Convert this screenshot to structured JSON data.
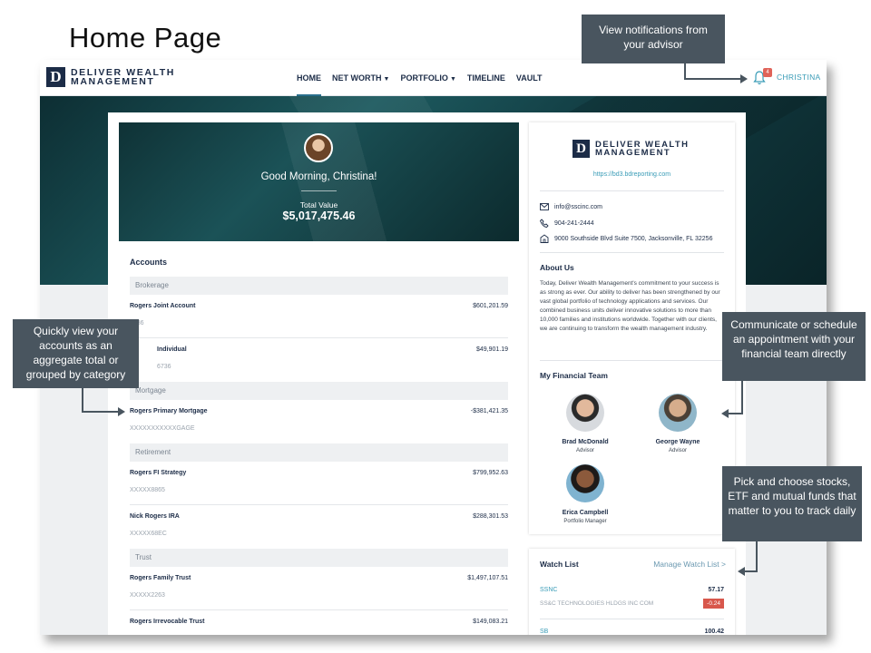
{
  "page_title": "Home Page",
  "nav": {
    "logo_mark": "D",
    "logo_line1": "DELIVER WEALTH",
    "logo_line2": "MANAGEMENT",
    "links": [
      {
        "label": "HOME",
        "dropdown": false
      },
      {
        "label": "NET WORTH",
        "dropdown": true
      },
      {
        "label": "PORTFOLIO",
        "dropdown": true
      },
      {
        "label": "TIMELINE",
        "dropdown": false
      },
      {
        "label": "VAULT",
        "dropdown": false
      }
    ],
    "notification_count": "4",
    "user_name": "CHRISTINA"
  },
  "hero": {
    "greeting": "Good Morning, Christina!",
    "total_label": "Total Value",
    "total_value": "$5,017,475.46"
  },
  "accounts": {
    "title": "Accounts",
    "categories": {
      "brokerage": "Brokerage",
      "mortgage": "Mortgage",
      "retirement": "Retirement",
      "trust": "Trust"
    },
    "items": [
      {
        "name": "Rogers Joint Account",
        "number": "1886",
        "value": "$601,201.59"
      },
      {
        "name": "Individual",
        "number": "6736",
        "value": "$49,901.19"
      },
      {
        "name": "Rogers Primary Mortgage",
        "number": "XXXXXXXXXXXGAGE",
        "value": "-$381,421.35"
      },
      {
        "name": "Rogers FI Strategy",
        "number": "XXXXX8865",
        "value": "$799,952.63"
      },
      {
        "name": "Nick Rogers IRA",
        "number": "XXXXX68EC",
        "value": "$288,301.53"
      },
      {
        "name": "Rogers Family Trust",
        "number": "XXXXX2263",
        "value": "$1,497,107.51"
      },
      {
        "name": "Rogers Irrevocable Trust",
        "number": "",
        "value": "$149,083.21"
      }
    ]
  },
  "firm": {
    "logo_mark": "D",
    "logo_line1": "DELIVER WEALTH",
    "logo_line2": "MANAGEMENT",
    "url": "https://bd3.bdreporting.com",
    "email": "info@sscinc.com",
    "phone": "904-241-2444",
    "address": "9000 Southside Blvd Suite 7500, Jacksonville, FL 32256",
    "about_title": "About Us",
    "about_text": "Today, Deliver Wealth Management's commitment to your success is as strong as ever. Our ability to deliver has been strengthened by our vast global portfolio of technology applications and services. Our combined business units deliver innovative solutions to more than 10,000 families and institutions worldwide. Together with our clients, we are continuing to transform the wealth management industry.",
    "team_title": "My Financial Team",
    "team": [
      {
        "name": "Brad McDonald",
        "role": "Advisor"
      },
      {
        "name": "George Wayne",
        "role": "Advisor"
      },
      {
        "name": "Erica Campbell",
        "role": "Portfolio Manager"
      }
    ]
  },
  "watchlist": {
    "title": "Watch List",
    "manage_label": "Manage Watch List >",
    "items": [
      {
        "symbol": "SSNC",
        "name": "SS&C TECHNOLOGIES HLDGS INC COM",
        "price": "57.17",
        "change": "-0.24"
      },
      {
        "symbol": "SB",
        "price": "100.42"
      }
    ]
  },
  "callouts": {
    "notifications": "View notifications from your advisor",
    "accounts": "Quickly view  your accounts as an aggregate total or grouped  by category",
    "team": "Communicate or schedule an appointment with your financial team directly",
    "watchlist": "Pick and choose stocks, ETF and mutual funds that matter to you to track daily"
  },
  "colors": {
    "brand_navy": "#1c2c47",
    "accent_teal": "#3a9cb7",
    "callout_gray": "#49555f",
    "negative_red": "#d8574c"
  }
}
